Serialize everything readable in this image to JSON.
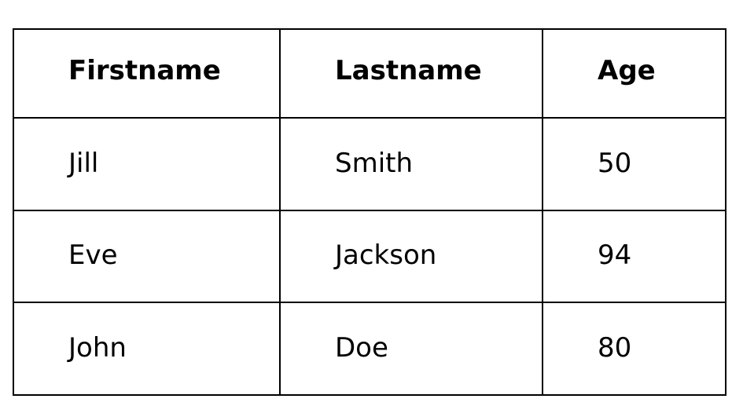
{
  "table": {
    "headers": [
      "Firstname",
      "Lastname",
      "Age"
    ],
    "rows": [
      [
        "Jill",
        "Smith",
        "50"
      ],
      [
        "Eve",
        "Jackson",
        "94"
      ],
      [
        "John",
        "Doe",
        "80"
      ]
    ]
  }
}
